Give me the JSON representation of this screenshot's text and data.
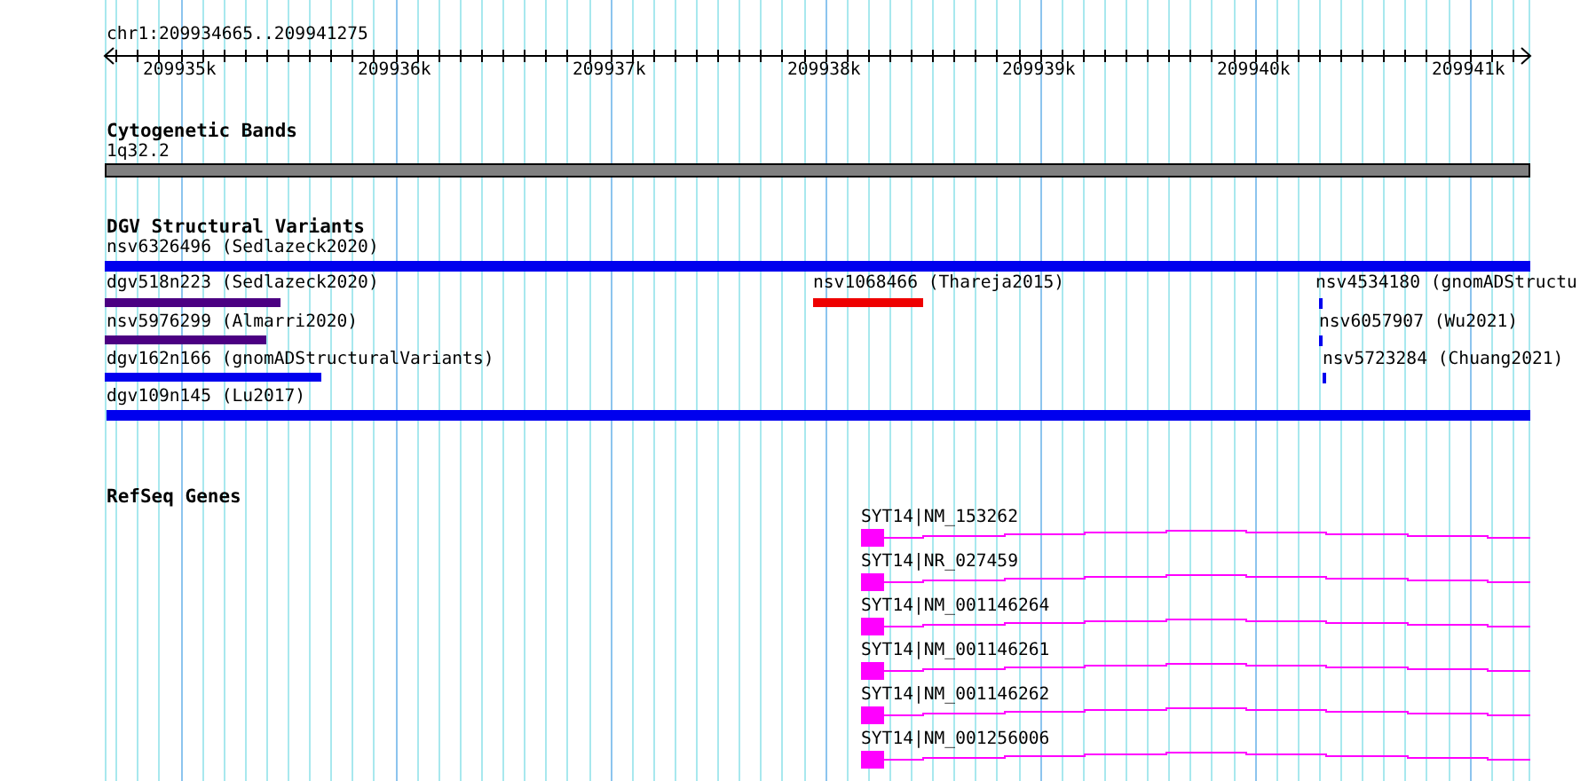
{
  "ruler": {
    "location": "chr1:209934665..209941275",
    "ticks": [
      "209935k",
      "209936k",
      "209937k",
      "209938k",
      "209939k",
      "209940k",
      "209941k"
    ]
  },
  "tracks": [
    {
      "kind": "bands",
      "title": "Cytogenetic Bands",
      "features": [
        {
          "label": "1q32.2",
          "color": "#808080"
        }
      ]
    },
    {
      "kind": "variants",
      "title": "DGV Structural Variants",
      "features": [
        {
          "label": "nsv6326496 (Sedlazeck2020)",
          "color": "#0000ee"
        },
        {
          "label": "dgv518n223 (Sedlazeck2020)",
          "color": "#4b0082"
        },
        {
          "label": "nsv1068466 (Thareja2015)",
          "color": "#ee0000"
        },
        {
          "label": "nsv4534180 (gnomADStructu",
          "color": "#0000ee"
        },
        {
          "label": "nsv5976299 (Almarri2020)",
          "color": "#4b0082"
        },
        {
          "label": "nsv6057907 (Wu2021)",
          "color": "#0000ee"
        },
        {
          "label": "dgv162n166 (gnomADStructuralVariants)",
          "color": "#0000ee"
        },
        {
          "label": "nsv5723284 (Chuang2021)",
          "color": "#0000ee"
        },
        {
          "label": "dgv109n145 (Lu2017)",
          "color": "#0000ee"
        }
      ]
    },
    {
      "kind": "genes",
      "title": "RefSeq Genes",
      "features": [
        {
          "label": "SYT14|NM_153262",
          "color": "#ff00ff"
        },
        {
          "label": "SYT14|NR_027459",
          "color": "#ff00ff"
        },
        {
          "label": "SYT14|NM_001146264",
          "color": "#ff00ff"
        },
        {
          "label": "SYT14|NM_001146261",
          "color": "#ff00ff"
        },
        {
          "label": "SYT14|NM_001146262",
          "color": "#ff00ff"
        },
        {
          "label": "SYT14|NM_001256006",
          "color": "#ff00ff"
        }
      ]
    }
  ]
}
